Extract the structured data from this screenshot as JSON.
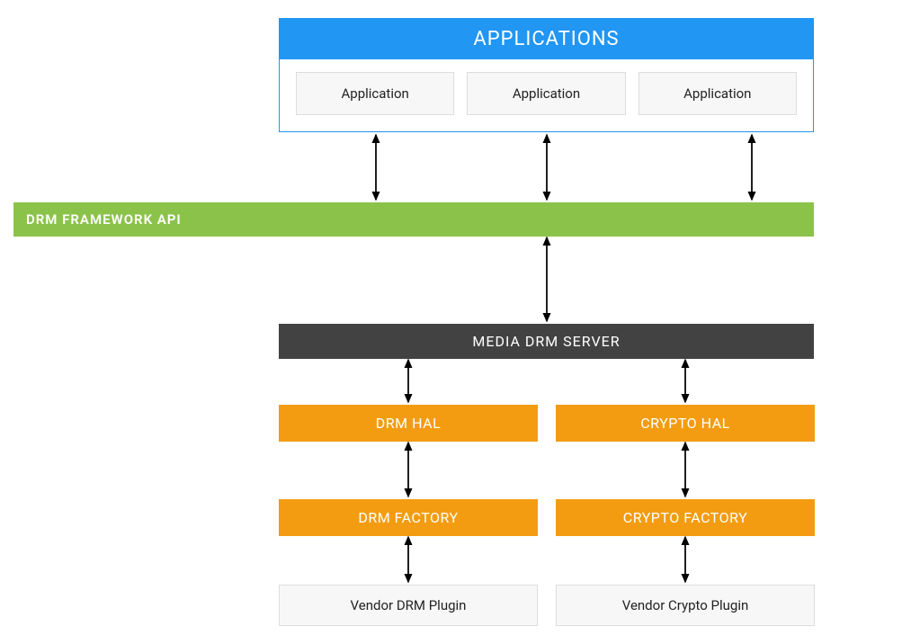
{
  "applications": {
    "title": "APPLICATIONS",
    "items": [
      "Application",
      "Application",
      "Application"
    ]
  },
  "drm_api": {
    "label": "DRM FRAMEWORK API"
  },
  "media_server": {
    "label": "MEDIA DRM SERVER"
  },
  "hal": {
    "drm": "DRM HAL",
    "crypto": "CRYPTO HAL"
  },
  "factory": {
    "drm": "DRM FACTORY",
    "crypto": "CRYPTO FACTORY"
  },
  "vendor": {
    "drm": "Vendor DRM Plugin",
    "crypto": "Vendor Crypto Plugin"
  },
  "colors": {
    "blue": "#2196f3",
    "green": "#8bc34a",
    "dark": "#424242",
    "orange": "#f39c12",
    "lightgrey": "#f7f7f7"
  }
}
